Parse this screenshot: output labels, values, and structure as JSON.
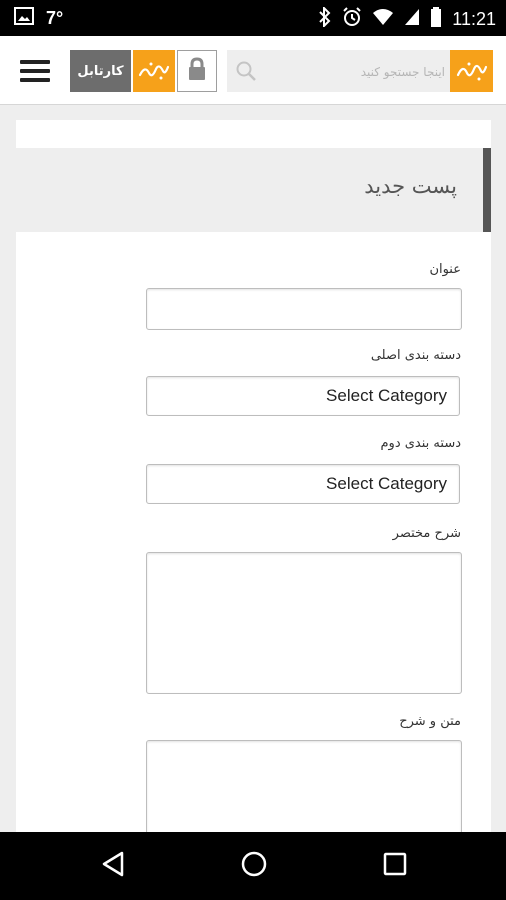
{
  "status_bar": {
    "temperature": "7°",
    "time": "11:21",
    "icons": [
      "image-icon",
      "bluetooth-icon",
      "alarm-icon",
      "wifi-icon",
      "signal-icon",
      "battery-icon"
    ]
  },
  "header": {
    "cartable_label": "کارتابل",
    "search_placeholder": "اینجا جستجو کنید",
    "brand_color": "#f6a11a"
  },
  "form": {
    "title": "پست جدید",
    "fields": [
      {
        "label": "عنوان",
        "type": "text",
        "value": ""
      },
      {
        "label": "دسته بندی اصلی",
        "type": "select",
        "value": "Select Category"
      },
      {
        "label": "دسته بندی دوم",
        "type": "select",
        "value": "Select Category"
      },
      {
        "label": "شرح مختصر",
        "type": "textarea",
        "value": ""
      },
      {
        "label": "متن و شرح",
        "type": "textarea",
        "value": ""
      }
    ]
  }
}
